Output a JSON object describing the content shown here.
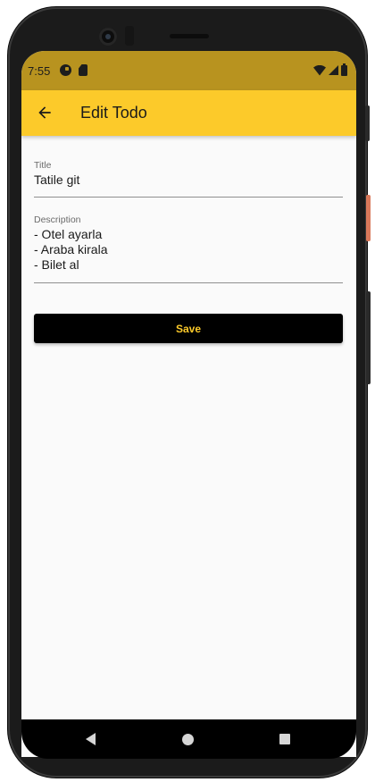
{
  "status_bar": {
    "time": "7:55",
    "left_icons": [
      "g-icon",
      "sd-card-icon"
    ],
    "right_icons": [
      "wifi-icon",
      "signal-icon",
      "battery-icon"
    ],
    "background": "#b8931f"
  },
  "app_bar": {
    "back_icon": "arrow-back-icon",
    "title": "Edit Todo",
    "background": "#fcca2a"
  },
  "form": {
    "title_label": "Title",
    "title_value": "Tatile git",
    "description_label": "Description",
    "description_value": "- Otel ayarla\n- Araba kirala\n- Bilet al"
  },
  "save_button": {
    "label": "Save",
    "background": "#000000",
    "text_color": "#fcca2a"
  },
  "nav_bar": {
    "icons": [
      "nav-back-icon",
      "nav-home-icon",
      "nav-recents-icon"
    ]
  }
}
